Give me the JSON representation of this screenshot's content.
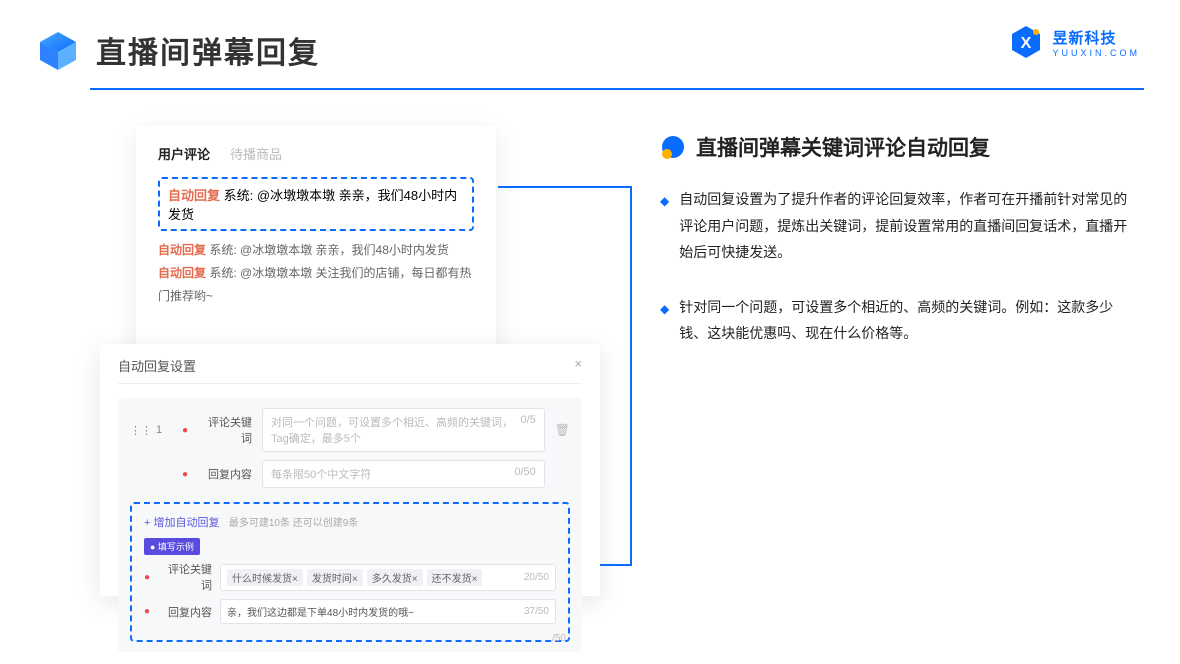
{
  "header": {
    "title": "直播间弹幕回复"
  },
  "brand": {
    "cn": "昱新科技",
    "en": "YUUXIN.COM"
  },
  "cardA": {
    "tab_active": "用户评论",
    "tab_inactive": "待播商品",
    "tag": "自动回复",
    "sys_prefix": "系统: ",
    "line1": "@冰墩墩本墩 亲亲，我们48小时内发货",
    "line2": "@冰墩墩本墩 亲亲，我们48小时内发货",
    "line3": "@冰墩墩本墩 关注我们的店铺，每日都有热门推荐哟~"
  },
  "cardB": {
    "title": "自动回复设置",
    "idx": "1",
    "label_keyword": "评论关键词",
    "placeholder_keyword": "对同一个问题，可设置多个相近、高频的关键词，Tag确定，最多5个",
    "count_keyword": "0/5",
    "label_content": "回复内容",
    "placeholder_content": "每条限50个中文字符",
    "count_content": "0/50",
    "add_link": "+ 增加自动回复",
    "add_hint": "最多可建10条 还可以创建9条",
    "example_tag": "● 填写示例",
    "ex_row1_label": "评论关键词",
    "ex_chips": [
      "什么时候发货×",
      "发货时间×",
      "多久发货×",
      "还不发货×"
    ],
    "ex_row1_count": "20/50",
    "ex_row2_label": "回复内容",
    "ex_row2_value": "亲，我们这边都是下单48小时内发货的哦~",
    "ex_row2_count": "37/50",
    "ex_side_count": "/50"
  },
  "right": {
    "heading": "直播间弹幕关键词评论自动回复",
    "p1": "自动回复设置为了提升作者的评论回复效率，作者可在开播前针对常见的评论用户问题，提炼出关键词，提前设置常用的直播间回复话术，直播开始后可快捷发送。",
    "p2": "针对同一个问题，可设置多个相近的、高频的关键词。例如：这款多少钱、这块能优惠吗、现在什么价格等。"
  }
}
